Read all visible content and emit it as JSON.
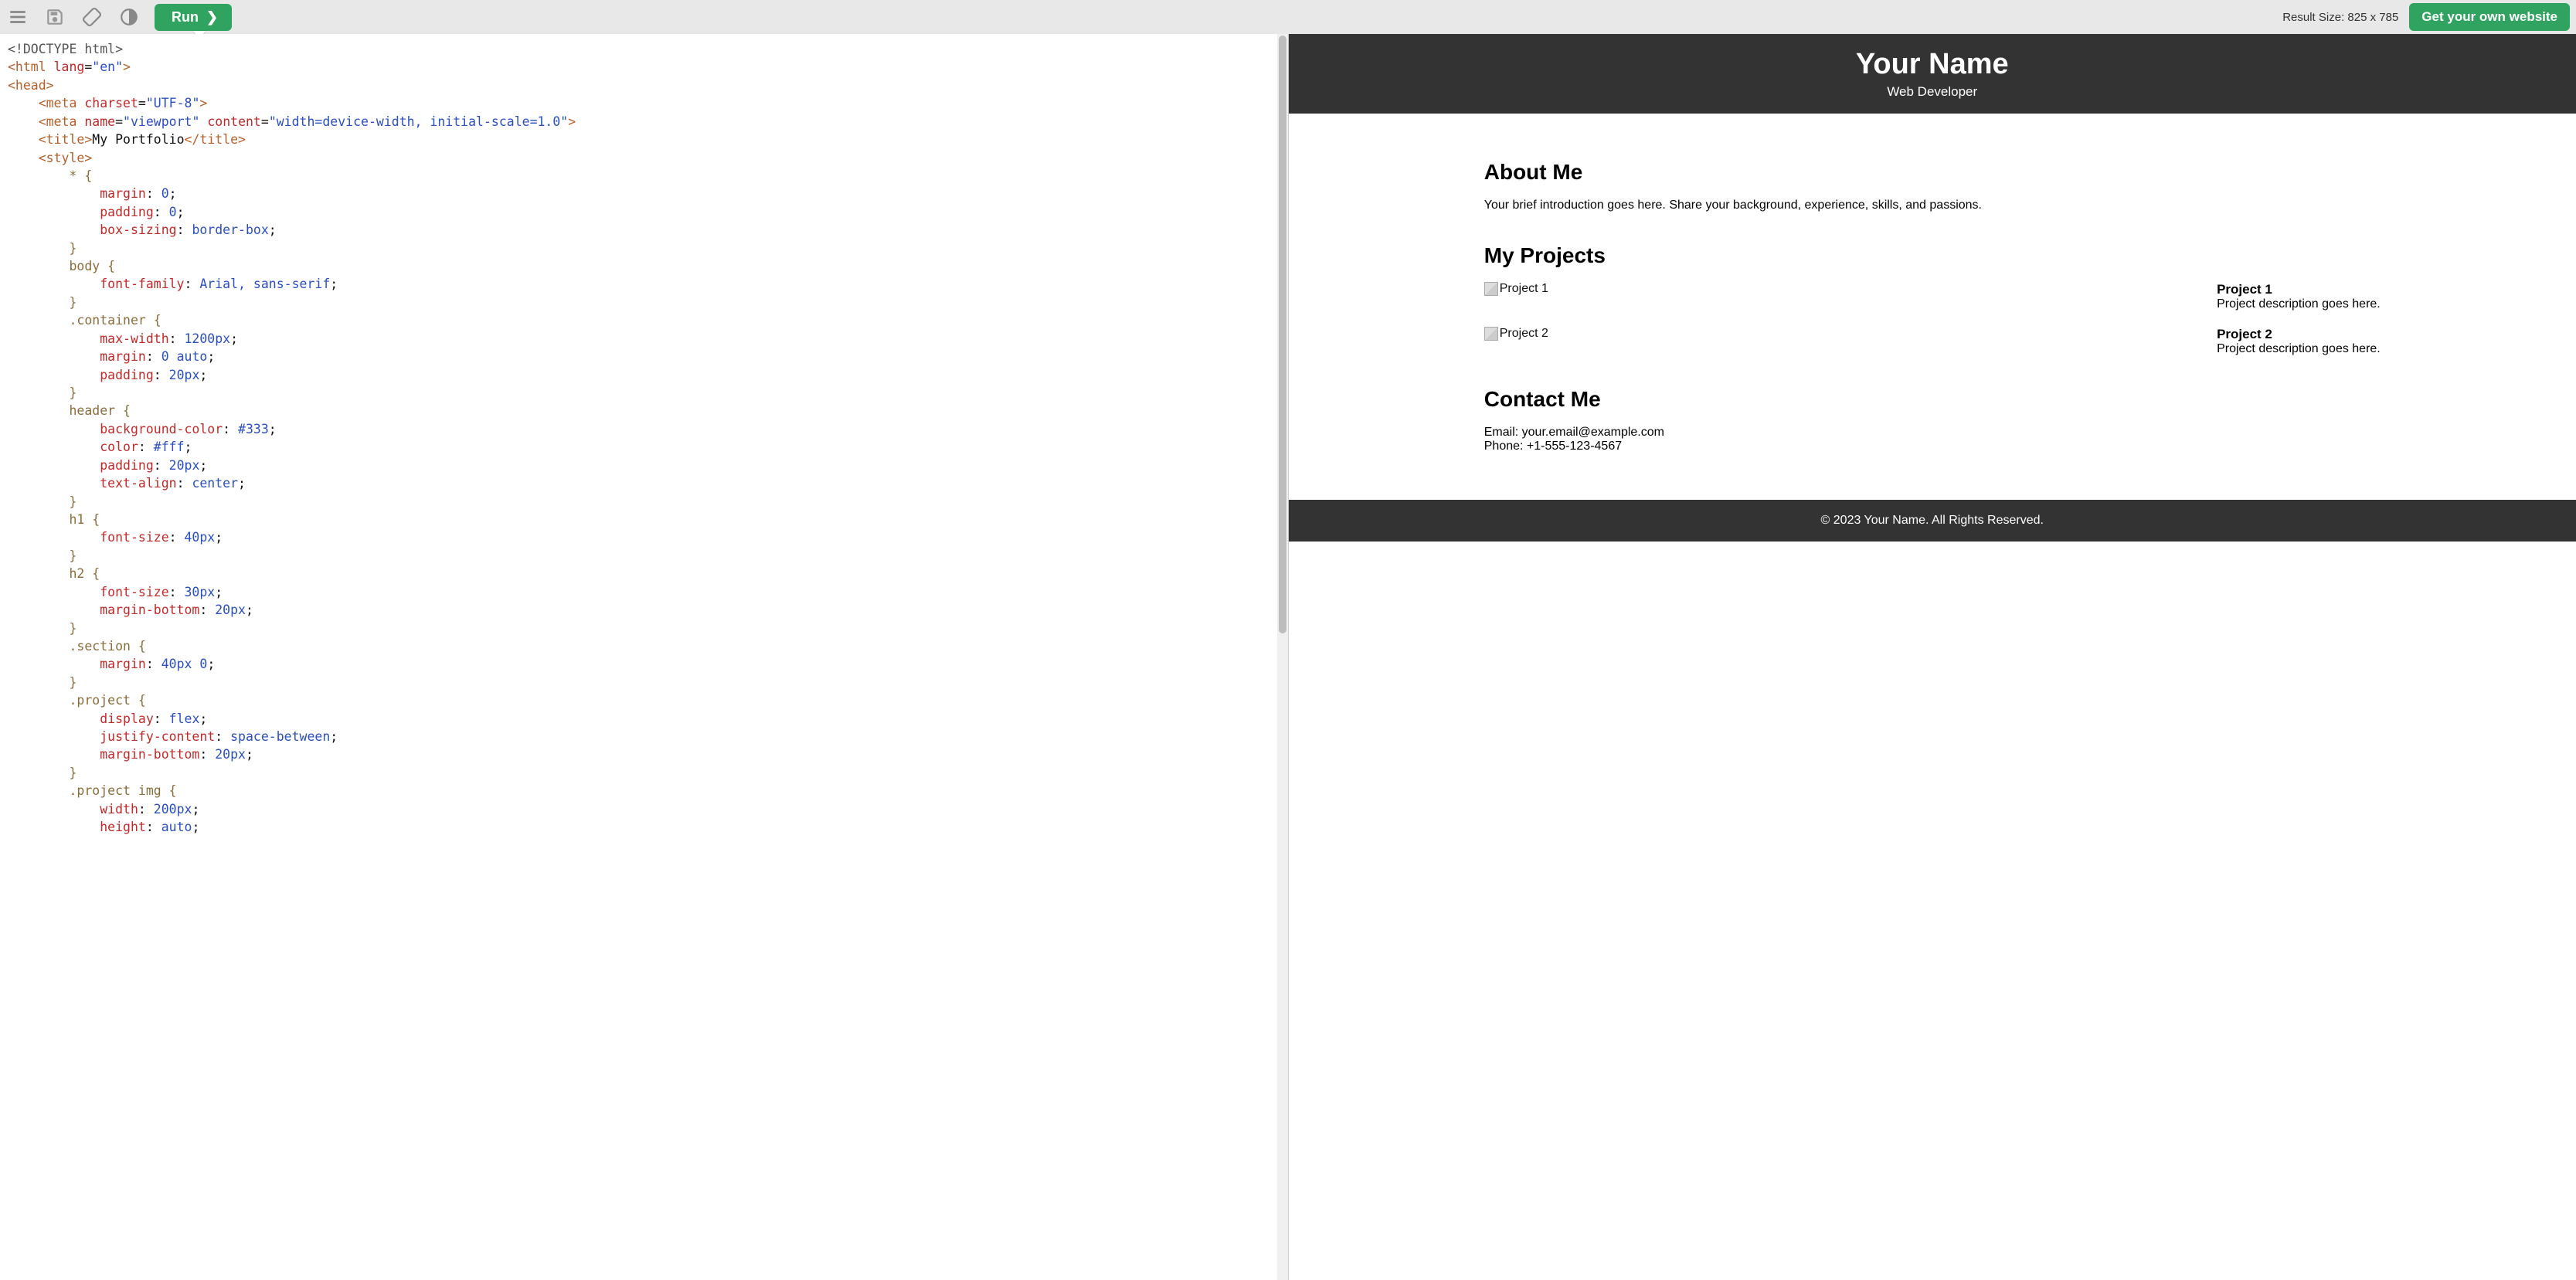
{
  "toolbar": {
    "run_label": "Run",
    "result_size_label": "Result Size: 825 x 785",
    "cta_label": "Get your own website"
  },
  "icons": {
    "menu": "menu-icon",
    "save": "save-icon",
    "rotate": "rotate-icon",
    "theme": "theme-icon"
  },
  "code_lines": [
    {
      "type": "doctype",
      "raw": "<!DOCTYPE html>"
    },
    {
      "type": "tagline",
      "indent": 0,
      "open": "<",
      "tag": "html",
      "attrs": [
        {
          "name": "lang",
          "value": "en"
        }
      ],
      "close": ">"
    },
    {
      "type": "tagline",
      "indent": 0,
      "open": "<",
      "tag": "head",
      "close": ">"
    },
    {
      "type": "tagline",
      "indent": 1,
      "open": "<",
      "tag": "meta",
      "attrs": [
        {
          "name": "charset",
          "value": "UTF-8"
        }
      ],
      "close": ">"
    },
    {
      "type": "tagline",
      "indent": 1,
      "open": "<",
      "tag": "meta",
      "attrs": [
        {
          "name": "name",
          "value": "viewport"
        },
        {
          "name": "content",
          "value": "width=device-width, initial-scale=1.0"
        }
      ],
      "close": ">"
    },
    {
      "type": "tagwrap",
      "indent": 1,
      "tag": "title",
      "inner": "My Portfolio"
    },
    {
      "type": "tagline",
      "indent": 1,
      "open": "<",
      "tag": "style",
      "close": ">"
    },
    {
      "type": "cssline",
      "indent": 2,
      "sel": "* {"
    },
    {
      "type": "cssprop",
      "indent": 3,
      "prop": "margin",
      "val": "0",
      "after": ";"
    },
    {
      "type": "cssprop",
      "indent": 3,
      "prop": "padding",
      "val": "0",
      "after": ";"
    },
    {
      "type": "cssprop",
      "indent": 3,
      "prop": "box-sizing",
      "val": "border-box",
      "after": ";"
    },
    {
      "type": "cssline",
      "indent": 2,
      "sel": "}"
    },
    {
      "type": "cssline",
      "indent": 2,
      "sel": "body {"
    },
    {
      "type": "cssprop",
      "indent": 3,
      "prop": "font-family",
      "val": "Arial, sans-serif",
      "after": ";"
    },
    {
      "type": "cssline",
      "indent": 2,
      "sel": "}"
    },
    {
      "type": "cssline",
      "indent": 2,
      "sel": ".container {"
    },
    {
      "type": "cssprop",
      "indent": 3,
      "prop": "max-width",
      "val": "1200px",
      "after": ";"
    },
    {
      "type": "cssprop",
      "indent": 3,
      "prop": "margin",
      "val": "0 auto",
      "after": ";"
    },
    {
      "type": "cssprop",
      "indent": 3,
      "prop": "padding",
      "val": "20px",
      "after": ";"
    },
    {
      "type": "cssline",
      "indent": 2,
      "sel": "}"
    },
    {
      "type": "cssline",
      "indent": 2,
      "sel": "header {"
    },
    {
      "type": "cssprop",
      "indent": 3,
      "prop": "background-color",
      "val": "#333",
      "after": ";"
    },
    {
      "type": "cssprop",
      "indent": 3,
      "prop": "color",
      "val": "#fff",
      "after": ";"
    },
    {
      "type": "cssprop",
      "indent": 3,
      "prop": "padding",
      "val": "20px",
      "after": ";"
    },
    {
      "type": "cssprop",
      "indent": 3,
      "prop": "text-align",
      "val": "center",
      "after": ";"
    },
    {
      "type": "cssline",
      "indent": 2,
      "sel": "}"
    },
    {
      "type": "cssline",
      "indent": 2,
      "sel": "h1 {"
    },
    {
      "type": "cssprop",
      "indent": 3,
      "prop": "font-size",
      "val": "40px",
      "after": ";"
    },
    {
      "type": "cssline",
      "indent": 2,
      "sel": "}"
    },
    {
      "type": "cssline",
      "indent": 2,
      "sel": "h2 {"
    },
    {
      "type": "cssprop",
      "indent": 3,
      "prop": "font-size",
      "val": "30px",
      "after": ";"
    },
    {
      "type": "cssprop",
      "indent": 3,
      "prop": "margin-bottom",
      "val": "20px",
      "after": ";"
    },
    {
      "type": "cssline",
      "indent": 2,
      "sel": "}"
    },
    {
      "type": "cssline",
      "indent": 2,
      "sel": ".section {"
    },
    {
      "type": "cssprop",
      "indent": 3,
      "prop": "margin",
      "val": "40px 0",
      "after": ";"
    },
    {
      "type": "cssline",
      "indent": 2,
      "sel": "}"
    },
    {
      "type": "cssline",
      "indent": 2,
      "sel": ".project {"
    },
    {
      "type": "cssprop",
      "indent": 3,
      "prop": "display",
      "val": "flex",
      "after": ";"
    },
    {
      "type": "cssprop",
      "indent": 3,
      "prop": "justify-content",
      "val": "space-between",
      "after": ";"
    },
    {
      "type": "cssprop",
      "indent": 3,
      "prop": "margin-bottom",
      "val": "20px",
      "after": ";"
    },
    {
      "type": "cssline",
      "indent": 2,
      "sel": "}"
    },
    {
      "type": "cssline",
      "indent": 2,
      "sel": ".project img {"
    },
    {
      "type": "cssprop",
      "indent": 3,
      "prop": "width",
      "val": "200px",
      "after": ";"
    },
    {
      "type": "cssprop",
      "indent": 3,
      "prop": "height",
      "val": "auto",
      "after": ";"
    }
  ],
  "preview": {
    "header": {
      "name": "Your Name",
      "role": "Web Developer"
    },
    "about": {
      "heading": "About Me",
      "text": "Your brief introduction goes here. Share your background, experience, skills, and passions."
    },
    "projects": {
      "heading": "My Projects",
      "items": [
        {
          "img_alt": "Project 1",
          "title": "Project 1",
          "desc": "Project description goes here."
        },
        {
          "img_alt": "Project 2",
          "title": "Project 2",
          "desc": "Project description goes here."
        }
      ]
    },
    "contact": {
      "heading": "Contact Me",
      "email_line": "Email: your.email@example.com",
      "phone_line": "Phone: +1-555-123-4567"
    },
    "footer": "© 2023 Your Name. All Rights Reserved."
  }
}
